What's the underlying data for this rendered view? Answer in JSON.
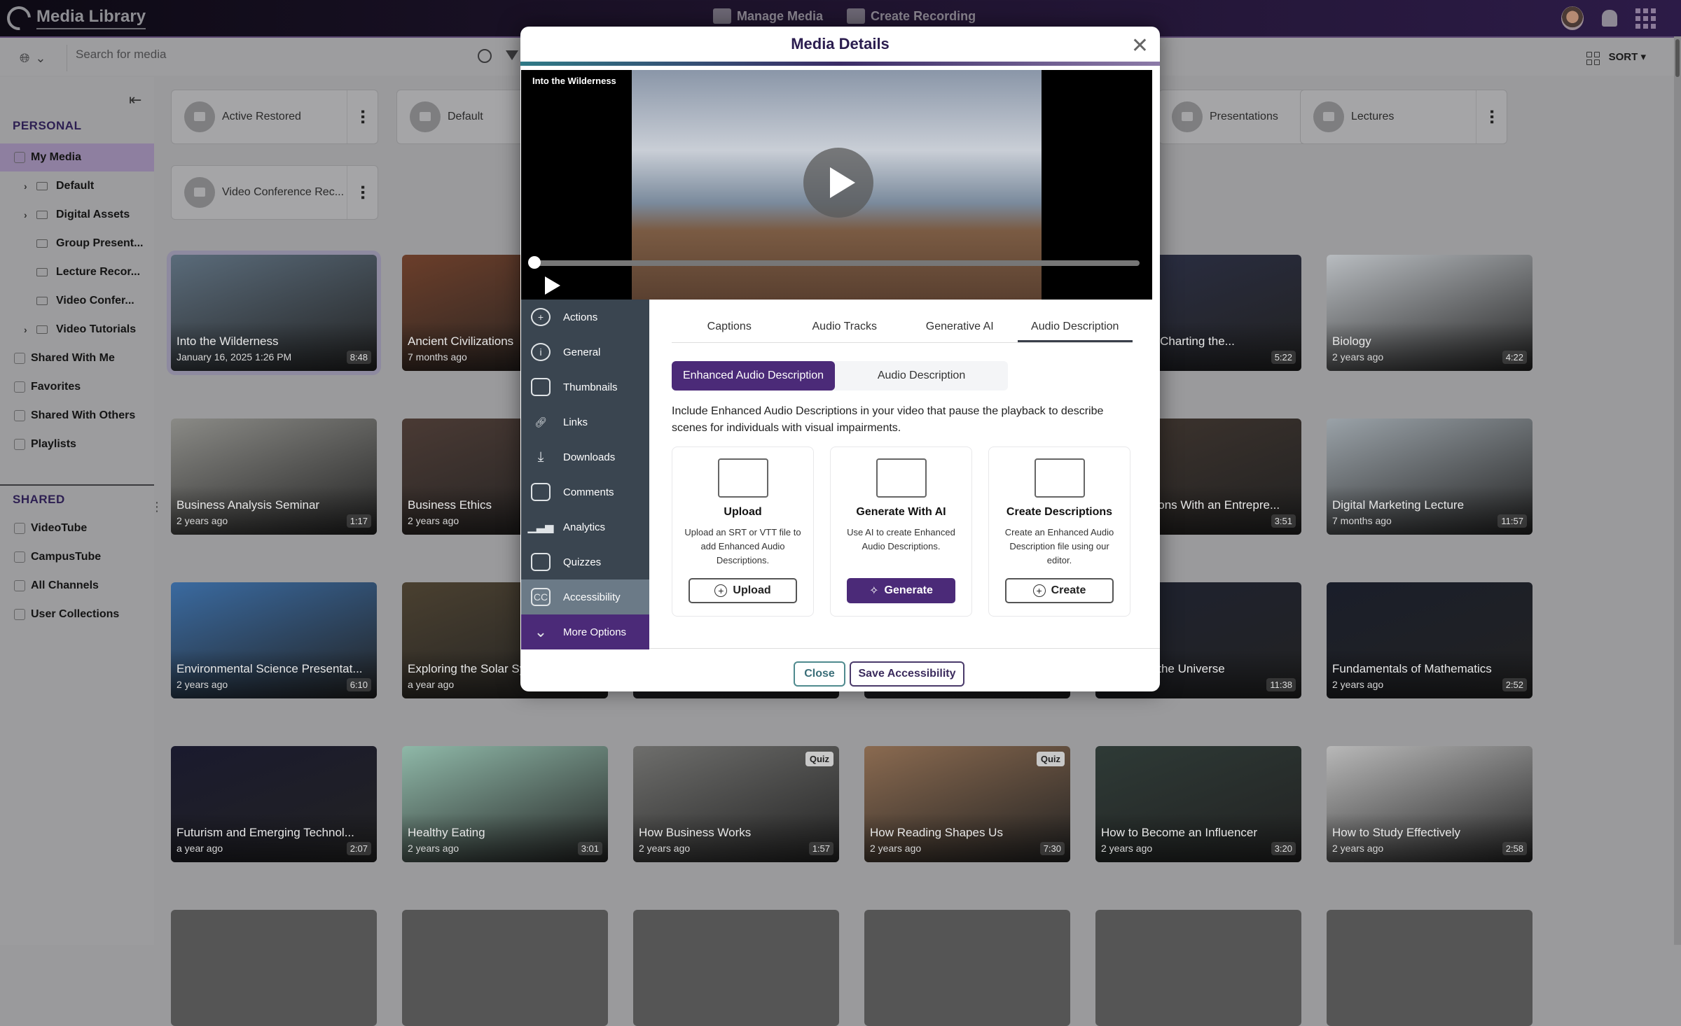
{
  "app": {
    "title": "Media Library",
    "top_nav": [
      {
        "label": "Manage Media",
        "icon": "folder-play-icon"
      },
      {
        "label": "Create Recording",
        "icon": "recording-icon"
      }
    ],
    "top_right_icons": [
      "user-avatar",
      "bell-icon",
      "apps-grid-icon"
    ]
  },
  "search": {
    "placeholder": "Search for media",
    "scope_icon": "globe-icon",
    "sort_label": "SORT"
  },
  "sidebar": {
    "personal_heading": "PERSONAL",
    "personal_items": [
      {
        "label": "My Media",
        "icon": "home-icon",
        "active": true
      },
      {
        "label": "Default",
        "icon": "folder-icon",
        "expandable": true
      },
      {
        "label": "Digital Assets",
        "icon": "folder-icon",
        "expandable": true
      },
      {
        "label": "Group Present...",
        "icon": "folder-icon"
      },
      {
        "label": "Lecture Recor...",
        "icon": "folder-icon"
      },
      {
        "label": "Video Confer...",
        "icon": "folder-icon"
      },
      {
        "label": "Video Tutorials",
        "icon": "folder-icon",
        "expandable": true
      },
      {
        "label": "Shared With Me",
        "icon": "share-icon"
      },
      {
        "label": "Favorites",
        "icon": "star-icon"
      },
      {
        "label": "Shared With Others",
        "icon": "users-share-icon"
      },
      {
        "label": "Playlists",
        "icon": "playlist-icon"
      }
    ],
    "shared_heading": "SHARED",
    "shared_items": [
      {
        "label": "VideoTube",
        "icon": "globe-icon"
      },
      {
        "label": "CampusTube",
        "icon": "building-icon"
      },
      {
        "label": "All Channels",
        "icon": "books-icon"
      },
      {
        "label": "User Collections",
        "icon": "user-icon"
      }
    ]
  },
  "folders": [
    {
      "name": "Active Restored"
    },
    {
      "name": "Default"
    },
    {
      "name": "Presentations"
    },
    {
      "name": "Lectures"
    },
    {
      "name": "Video Conference Rec..."
    }
  ],
  "media": [
    {
      "title": "Into the Wilderness",
      "sub": "January 16, 2025 1:26 PM",
      "duration": "8:48"
    },
    {
      "title": "Ancient Civilizations",
      "sub": "7 months ago",
      "duration": ""
    },
    {
      "title": "",
      "sub": "",
      "duration": ""
    },
    {
      "title": "",
      "sub": "",
      "duration": ""
    },
    {
      "title": "Tomorrow: Charting the...",
      "sub": "",
      "duration": "5:22"
    },
    {
      "title": "Biology",
      "sub": "2 years ago",
      "duration": "4:22"
    },
    {
      "title": "Business Analysis Seminar",
      "sub": "2 years ago",
      "duration": "1:17"
    },
    {
      "title": "Business Ethics",
      "sub": "2 years ago",
      "duration": ""
    },
    {
      "title": "",
      "sub": "",
      "duration": ""
    },
    {
      "title": "",
      "sub": "",
      "duration": ""
    },
    {
      "title": "Conversations With an Entrepre...",
      "sub": "",
      "duration": "3:51"
    },
    {
      "title": "Digital Marketing Lecture",
      "sub": "7 months ago",
      "duration": "11:57"
    },
    {
      "title": "Environmental Science Presentat...",
      "sub": "2 years ago",
      "duration": "6:10"
    },
    {
      "title": "Exploring the Solar System",
      "sub": "a year ago",
      "duration": ""
    },
    {
      "title": "",
      "sub": "",
      "duration": ""
    },
    {
      "title": "",
      "sub": "",
      "duration": ""
    },
    {
      "title": "Secrets of the Universe",
      "sub": "",
      "duration": "11:38"
    },
    {
      "title": "Fundamentals of Mathematics",
      "sub": "2 years ago",
      "duration": "2:52"
    },
    {
      "title": "Futurism and Emerging Technol...",
      "sub": "a year ago",
      "duration": "2:07"
    },
    {
      "title": "Healthy Eating",
      "sub": "2 years ago",
      "duration": "3:01"
    },
    {
      "title": "How Business Works",
      "sub": "2 years ago",
      "duration": "1:57",
      "badge": "Quiz"
    },
    {
      "title": "How Reading Shapes Us",
      "sub": "2 years ago",
      "duration": "7:30",
      "badge": "Quiz"
    },
    {
      "title": "How to Become an Influencer",
      "sub": "2 years ago",
      "duration": "3:20"
    },
    {
      "title": "How to Study Effectively",
      "sub": "2 years ago",
      "duration": "2:58"
    }
  ],
  "modal": {
    "title": "Media Details",
    "video_title": "Into the Wilderness",
    "playback_progress": 0,
    "left_nav": [
      {
        "label": "Actions",
        "icon": "plus-circle-icon"
      },
      {
        "label": "General",
        "icon": "info-icon"
      },
      {
        "label": "Thumbnails",
        "icon": "thumbnails-icon"
      },
      {
        "label": "Links",
        "icon": "link-icon"
      },
      {
        "label": "Downloads",
        "icon": "download-icon"
      },
      {
        "label": "Comments",
        "icon": "comments-icon"
      },
      {
        "label": "Analytics",
        "icon": "analytics-icon"
      },
      {
        "label": "Quizzes",
        "icon": "quiz-icon"
      },
      {
        "label": "Accessibility",
        "icon": "cc-icon",
        "active": true
      },
      {
        "label": "More Options",
        "icon": "chevron-down-icon"
      }
    ],
    "tabs": [
      "Captions",
      "Audio Tracks",
      "Generative AI",
      "Audio Description"
    ],
    "active_tab": "Audio Description",
    "segments": [
      "Enhanced Audio Description",
      "Audio Description"
    ],
    "active_segment": "Enhanced Audio Description",
    "intro": "Include Enhanced Audio Descriptions in your video that pause the playback to describe scenes for individuals with visual impairments.",
    "options": [
      {
        "title": "Upload",
        "desc": "Upload an SRT or VTT file to add Enhanced Audio Descriptions.",
        "button": "Upload",
        "btn_icon": "plus-circle-icon"
      },
      {
        "title": "Generate With AI",
        "desc": "Use AI to create Enhanced Audio Descriptions.",
        "button": "Generate",
        "btn_icon": "sparkle-icon"
      },
      {
        "title": "Create Descriptions",
        "desc": "Create an Enhanced Audio Description file using our editor.",
        "button": "Create",
        "btn_icon": "plus-circle-icon"
      }
    ],
    "footer": {
      "close": "Close",
      "save": "Save Accessibility"
    }
  }
}
